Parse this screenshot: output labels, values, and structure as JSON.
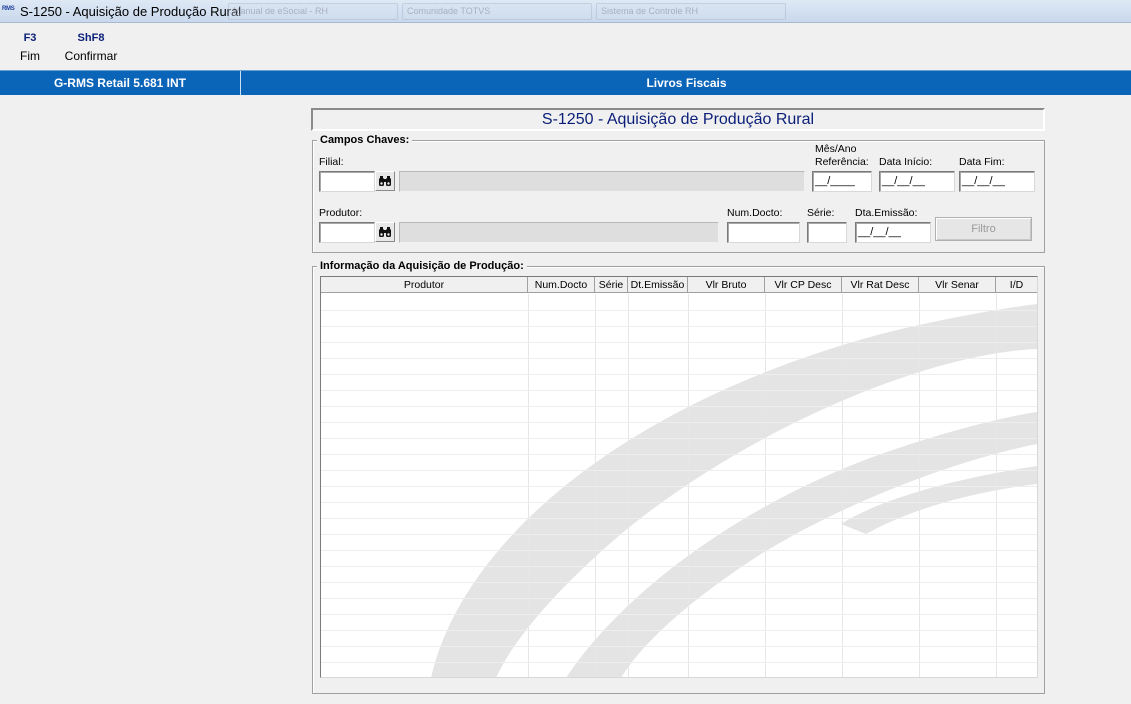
{
  "window": {
    "app_icon_text": "RMS",
    "title": "S-1250 - Aquisição de Produção Rural",
    "background_tabs": [
      "Manual de eSocial - RH",
      "Comunidade TOTVS",
      "Sistema de Controle RH"
    ]
  },
  "function_keys": [
    {
      "key": "F3",
      "label": "Fim"
    },
    {
      "key": "ShF8",
      "label": "Confirmar"
    }
  ],
  "header": {
    "system": "G-RMS Retail 5.681 INT",
    "module": "Livros Fiscais",
    "accent_color": "#0a64b8"
  },
  "form": {
    "title": "S-1250 - Aquisição de Produção Rural",
    "campos_chaves": {
      "legend": "Campos Chaves:",
      "filial_label": "Filial:",
      "filial_value": "",
      "filial_desc": "",
      "mes_ano_label_1": "Mês/Ano",
      "mes_ano_label_2": "Referência:",
      "mes_ano_value": "__/____",
      "data_inicio_label": "Data Início:",
      "data_inicio_value": "__/__/__",
      "data_fim_label": "Data Fim:",
      "data_fim_value": "__/__/__",
      "produtor_label": "Produtor:",
      "produtor_value": "",
      "produtor_desc": "",
      "num_docto_label": "Num.Docto:",
      "num_docto_value": "",
      "serie_label": "Série:",
      "serie_value": "",
      "dta_emissao_label": "Dta.Emissão:",
      "dta_emissao_value": "__/__/__",
      "filtro_label": "Filtro",
      "search_icon": "binoculars-icon"
    },
    "informacao": {
      "legend": "Informação da Aquisição de Produção:",
      "columns": [
        "Produtor",
        "Num.Docto",
        "Série",
        "Dt.Emissão",
        "Vlr Bruto",
        "Vlr CP Desc",
        "Vlr Rat Desc",
        "Vlr Senar",
        "I/D"
      ],
      "rows": []
    }
  }
}
